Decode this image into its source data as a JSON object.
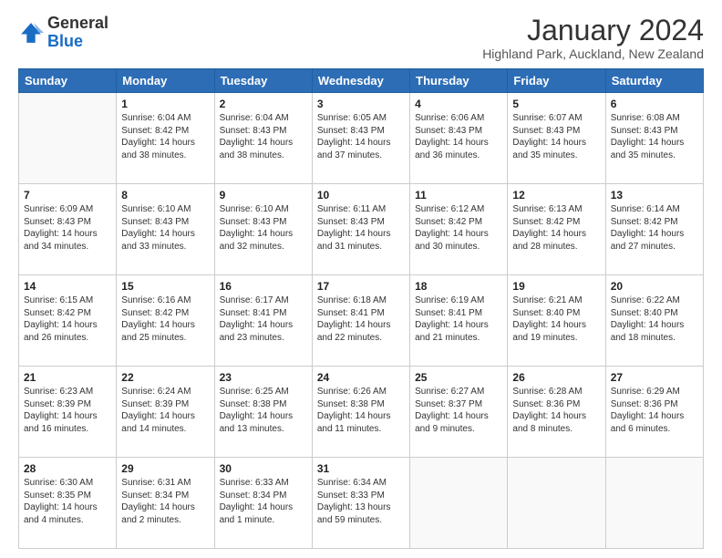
{
  "header": {
    "logo_general": "General",
    "logo_blue": "Blue",
    "month_title": "January 2024",
    "location": "Highland Park, Auckland, New Zealand"
  },
  "days_of_week": [
    "Sunday",
    "Monday",
    "Tuesday",
    "Wednesday",
    "Thursday",
    "Friday",
    "Saturday"
  ],
  "weeks": [
    [
      {
        "day": "",
        "info": ""
      },
      {
        "day": "1",
        "info": "Sunrise: 6:04 AM\nSunset: 8:42 PM\nDaylight: 14 hours\nand 38 minutes."
      },
      {
        "day": "2",
        "info": "Sunrise: 6:04 AM\nSunset: 8:43 PM\nDaylight: 14 hours\nand 38 minutes."
      },
      {
        "day": "3",
        "info": "Sunrise: 6:05 AM\nSunset: 8:43 PM\nDaylight: 14 hours\nand 37 minutes."
      },
      {
        "day": "4",
        "info": "Sunrise: 6:06 AM\nSunset: 8:43 PM\nDaylight: 14 hours\nand 36 minutes."
      },
      {
        "day": "5",
        "info": "Sunrise: 6:07 AM\nSunset: 8:43 PM\nDaylight: 14 hours\nand 35 minutes."
      },
      {
        "day": "6",
        "info": "Sunrise: 6:08 AM\nSunset: 8:43 PM\nDaylight: 14 hours\nand 35 minutes."
      }
    ],
    [
      {
        "day": "7",
        "info": "Sunrise: 6:09 AM\nSunset: 8:43 PM\nDaylight: 14 hours\nand 34 minutes."
      },
      {
        "day": "8",
        "info": "Sunrise: 6:10 AM\nSunset: 8:43 PM\nDaylight: 14 hours\nand 33 minutes."
      },
      {
        "day": "9",
        "info": "Sunrise: 6:10 AM\nSunset: 8:43 PM\nDaylight: 14 hours\nand 32 minutes."
      },
      {
        "day": "10",
        "info": "Sunrise: 6:11 AM\nSunset: 8:43 PM\nDaylight: 14 hours\nand 31 minutes."
      },
      {
        "day": "11",
        "info": "Sunrise: 6:12 AM\nSunset: 8:42 PM\nDaylight: 14 hours\nand 30 minutes."
      },
      {
        "day": "12",
        "info": "Sunrise: 6:13 AM\nSunset: 8:42 PM\nDaylight: 14 hours\nand 28 minutes."
      },
      {
        "day": "13",
        "info": "Sunrise: 6:14 AM\nSunset: 8:42 PM\nDaylight: 14 hours\nand 27 minutes."
      }
    ],
    [
      {
        "day": "14",
        "info": "Sunrise: 6:15 AM\nSunset: 8:42 PM\nDaylight: 14 hours\nand 26 minutes."
      },
      {
        "day": "15",
        "info": "Sunrise: 6:16 AM\nSunset: 8:42 PM\nDaylight: 14 hours\nand 25 minutes."
      },
      {
        "day": "16",
        "info": "Sunrise: 6:17 AM\nSunset: 8:41 PM\nDaylight: 14 hours\nand 23 minutes."
      },
      {
        "day": "17",
        "info": "Sunrise: 6:18 AM\nSunset: 8:41 PM\nDaylight: 14 hours\nand 22 minutes."
      },
      {
        "day": "18",
        "info": "Sunrise: 6:19 AM\nSunset: 8:41 PM\nDaylight: 14 hours\nand 21 minutes."
      },
      {
        "day": "19",
        "info": "Sunrise: 6:21 AM\nSunset: 8:40 PM\nDaylight: 14 hours\nand 19 minutes."
      },
      {
        "day": "20",
        "info": "Sunrise: 6:22 AM\nSunset: 8:40 PM\nDaylight: 14 hours\nand 18 minutes."
      }
    ],
    [
      {
        "day": "21",
        "info": "Sunrise: 6:23 AM\nSunset: 8:39 PM\nDaylight: 14 hours\nand 16 minutes."
      },
      {
        "day": "22",
        "info": "Sunrise: 6:24 AM\nSunset: 8:39 PM\nDaylight: 14 hours\nand 14 minutes."
      },
      {
        "day": "23",
        "info": "Sunrise: 6:25 AM\nSunset: 8:38 PM\nDaylight: 14 hours\nand 13 minutes."
      },
      {
        "day": "24",
        "info": "Sunrise: 6:26 AM\nSunset: 8:38 PM\nDaylight: 14 hours\nand 11 minutes."
      },
      {
        "day": "25",
        "info": "Sunrise: 6:27 AM\nSunset: 8:37 PM\nDaylight: 14 hours\nand 9 minutes."
      },
      {
        "day": "26",
        "info": "Sunrise: 6:28 AM\nSunset: 8:36 PM\nDaylight: 14 hours\nand 8 minutes."
      },
      {
        "day": "27",
        "info": "Sunrise: 6:29 AM\nSunset: 8:36 PM\nDaylight: 14 hours\nand 6 minutes."
      }
    ],
    [
      {
        "day": "28",
        "info": "Sunrise: 6:30 AM\nSunset: 8:35 PM\nDaylight: 14 hours\nand 4 minutes."
      },
      {
        "day": "29",
        "info": "Sunrise: 6:31 AM\nSunset: 8:34 PM\nDaylight: 14 hours\nand 2 minutes."
      },
      {
        "day": "30",
        "info": "Sunrise: 6:33 AM\nSunset: 8:34 PM\nDaylight: 14 hours\nand 1 minute."
      },
      {
        "day": "31",
        "info": "Sunrise: 6:34 AM\nSunset: 8:33 PM\nDaylight: 13 hours\nand 59 minutes."
      },
      {
        "day": "",
        "info": ""
      },
      {
        "day": "",
        "info": ""
      },
      {
        "day": "",
        "info": ""
      }
    ]
  ]
}
